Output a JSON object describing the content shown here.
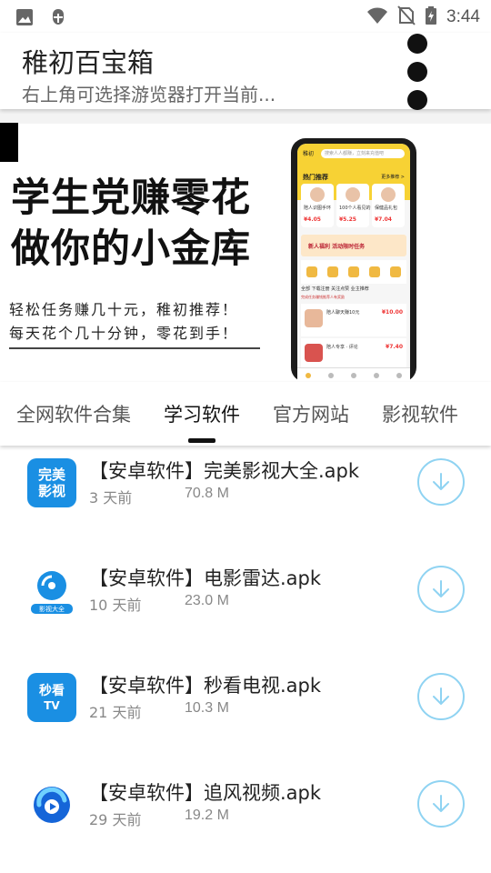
{
  "status_bar": {
    "time": "3:44",
    "left_icons": [
      "image-icon",
      "bug-icon"
    ],
    "right_icons": [
      "wifi-icon",
      "no-sim-icon",
      "battery-charging-icon"
    ]
  },
  "app_header": {
    "title": "稚初百宝箱",
    "subtitle": "右上角可选择游览器打开当前..."
  },
  "banner": {
    "headline_line1": "学生党赚零花",
    "headline_line2": "做你的小金库",
    "sub_line1": "轻松任务赚几十元，稚初推荐！",
    "sub_line2": "每天花个几十分钟，零花到手！",
    "phone_screen": {
      "logo": "稚初",
      "search": "搜索人人都赚，立刻来充值吧",
      "hot_title": "热门推荐",
      "hot_more": "更多推荐 >",
      "cards": [
        {
          "title": "陪人识图手环",
          "price": "¥4.05"
        },
        {
          "title": "100个人看见的",
          "price": "¥5.25"
        },
        {
          "title": "保健品礼包",
          "price": "¥7.04"
        }
      ],
      "promo": "新人福利 活动限时任务",
      "tabs": "全部  下载注册  关注点赞  业主推荐",
      "note": "完成任务赚钱推荐人有奖励",
      "rows": [
        {
          "title": "陪人聊天赚10元",
          "price": "¥10.00"
        },
        {
          "title": "陪人专享 · 评论",
          "price": "¥7.40"
        }
      ]
    }
  },
  "tabs": [
    {
      "label": "全网软件合集",
      "active": false
    },
    {
      "label": "学习软件",
      "active": true
    },
    {
      "label": "官方网站",
      "active": false
    },
    {
      "label": "影视软件",
      "active": false
    }
  ],
  "files": [
    {
      "title": "【安卓软件】完美影视大全.apk",
      "age": "3 天前",
      "size": "70.8 M",
      "icon": "wanmei-yingshi-app-icon",
      "icon_text_1": "完美",
      "icon_text_2": "影视"
    },
    {
      "title": "【安卓软件】电影雷达.apk",
      "age": "10 天前",
      "size": "23.0 M",
      "icon": "dianying-leida-app-icon",
      "icon_text_1": "影视大全",
      "icon_text_2": ""
    },
    {
      "title": "【安卓软件】秒看电视.apk",
      "age": "21 天前",
      "size": "10.3 M",
      "icon": "miaokan-tv-app-icon",
      "icon_text_1": "秒看",
      "icon_text_2": "TV"
    },
    {
      "title": "【安卓软件】追风视频.apk",
      "age": "29 天前",
      "size": "19.2 M",
      "icon": "zhuifeng-video-app-icon",
      "icon_text_1": "",
      "icon_text_2": ""
    }
  ],
  "colors": {
    "accent_download": "#8fd3f2",
    "brand_yellow": "#f7d234",
    "app_blue": "#1a8fe3"
  }
}
